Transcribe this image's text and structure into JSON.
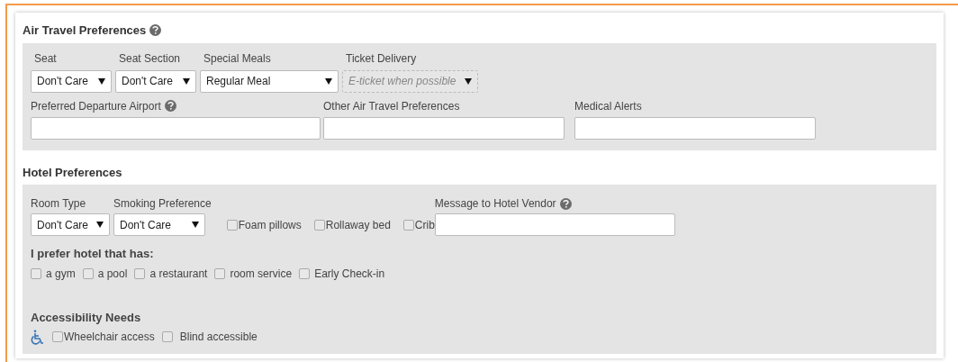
{
  "air_travel": {
    "title": "Air Travel Preferences",
    "selects": [
      {
        "label": "Seat",
        "value": "Don't Care",
        "disabled": false
      },
      {
        "label": "Seat Section",
        "value": "Don't Care",
        "disabled": false
      },
      {
        "label": "Special Meals",
        "value": "Regular Meal",
        "disabled": false
      },
      {
        "label": "Ticket Delivery",
        "value": "E-ticket when possible",
        "disabled": true
      }
    ],
    "fields": [
      {
        "label": "Preferred Departure Airport",
        "help": true
      },
      {
        "label": "Other Air Travel Preferences",
        "help": false
      },
      {
        "label": "Medical Alerts",
        "help": false
      }
    ]
  },
  "hotel": {
    "title": "Hotel Preferences",
    "selects": [
      {
        "label": "Room Type",
        "value": "Don't Care"
      },
      {
        "label": "Smoking Preference",
        "value": "Don't Care"
      }
    ],
    "options": [
      {
        "label": "Foam pillows",
        "checked": false
      },
      {
        "label": "Rollaway bed",
        "checked": false
      },
      {
        "label": "Crib",
        "checked": false
      }
    ],
    "message_field": {
      "label": "Message to Hotel Vendor"
    },
    "amenities_title": "I prefer hotel that has:",
    "amenities": [
      {
        "label": "a gym",
        "checked": false
      },
      {
        "label": "a pool",
        "checked": false
      },
      {
        "label": "a restaurant",
        "checked": false
      },
      {
        "label": "room service",
        "checked": false
      },
      {
        "label": "Early Check-in",
        "checked": false
      }
    ],
    "accessibility_title": "Accessibility Needs",
    "accessibility": [
      {
        "label": "Wheelchair access",
        "checked": false
      },
      {
        "label": "Blind accessible",
        "checked": false
      }
    ]
  }
}
